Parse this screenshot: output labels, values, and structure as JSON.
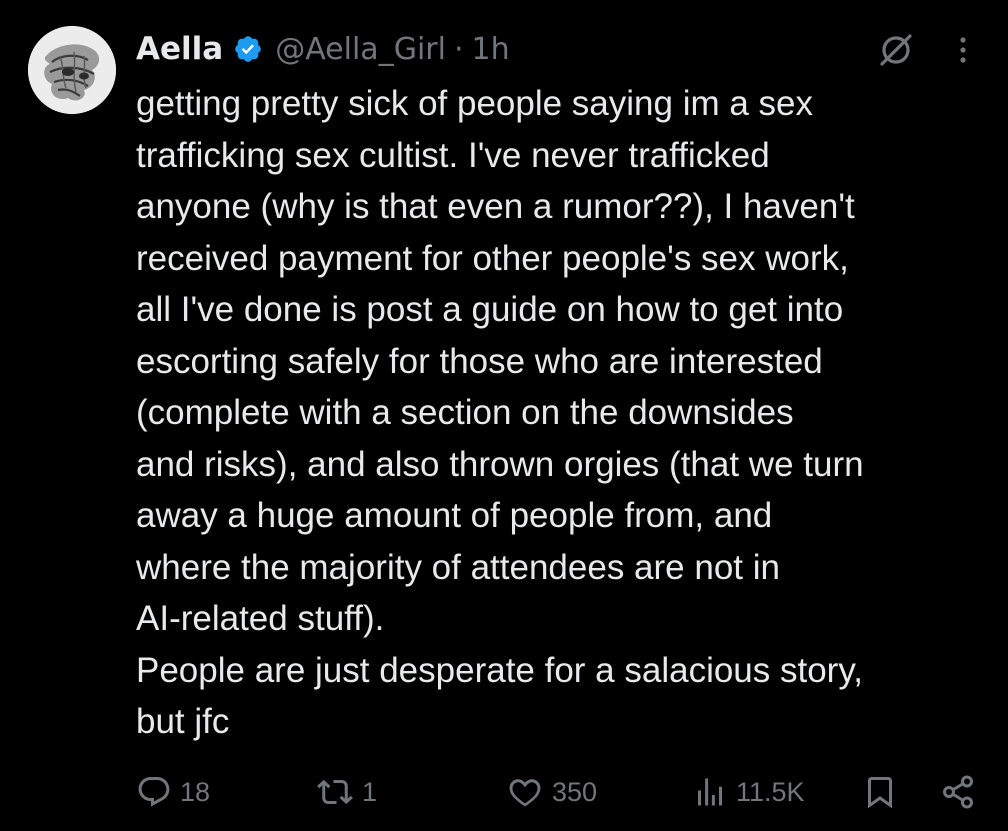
{
  "author": {
    "display_name": "Aella",
    "handle": "@Aella_Girl",
    "separator": "·",
    "time": "1h",
    "verified": true,
    "verified_color": "#1d9bf0"
  },
  "tweet": {
    "text": "getting pretty sick of people saying im a sex\ntrafficking sex cultist. I've never trafficked\nanyone (why is that even a rumor??), I haven't\nreceived payment for other people's sex work,\nall I've done is post a guide on how to get into\nescorting safely for those who are interested\n(complete with a section on the downsides\nand risks), and also thrown orgies (that we turn\naway a huge amount of people from, and\nwhere the majority of attendees are not in\nAI-related stuff).\nPeople are just desperate for a salacious story,\nbut jfc"
  },
  "actions": {
    "reply_count": "18",
    "retweet_count": "1",
    "like_count": "350",
    "views_count": "11.5K"
  },
  "icons": {
    "avatar": "avatar-image",
    "verified": "verified-badge-icon",
    "grok": "grok-icon",
    "more": "more-options-icon",
    "reply": "reply-icon",
    "retweet": "retweet-icon",
    "like": "heart-icon",
    "views": "views-icon",
    "bookmark": "bookmark-icon",
    "share": "share-icon"
  },
  "colors": {
    "background": "#000000",
    "text_primary": "#e7e9ea",
    "text_secondary": "#71767b",
    "accent": "#1d9bf0"
  }
}
